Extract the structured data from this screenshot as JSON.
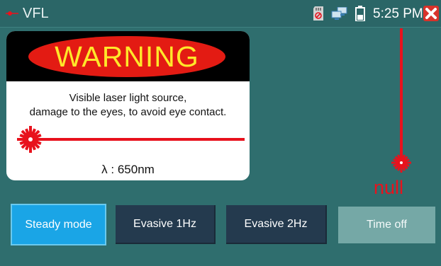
{
  "app": {
    "title": "VFL"
  },
  "status": {
    "time": "5:25 PM"
  },
  "warning": {
    "heading": "WARNING",
    "line1": "Visible laser light source,",
    "line2": "damage to the eyes, to avoid eye contact.",
    "wavelength": "λ : 650nm"
  },
  "probe": {
    "value": "null"
  },
  "buttons": {
    "steady": "Steady mode",
    "evasive1": "Evasive 1Hz",
    "evasive2": "Evasive 2Hz",
    "timeoff": "Time off"
  },
  "colors": {
    "background": "#2f6e6e",
    "laser_red": "#e8121d",
    "active_button": "#1aa5e6",
    "dark_button": "#243a4e"
  },
  "icons": {
    "app": "laser-icon",
    "sd": "sd-card-icon",
    "network": "network-icon",
    "battery": "battery-icon",
    "close": "close-icon"
  }
}
